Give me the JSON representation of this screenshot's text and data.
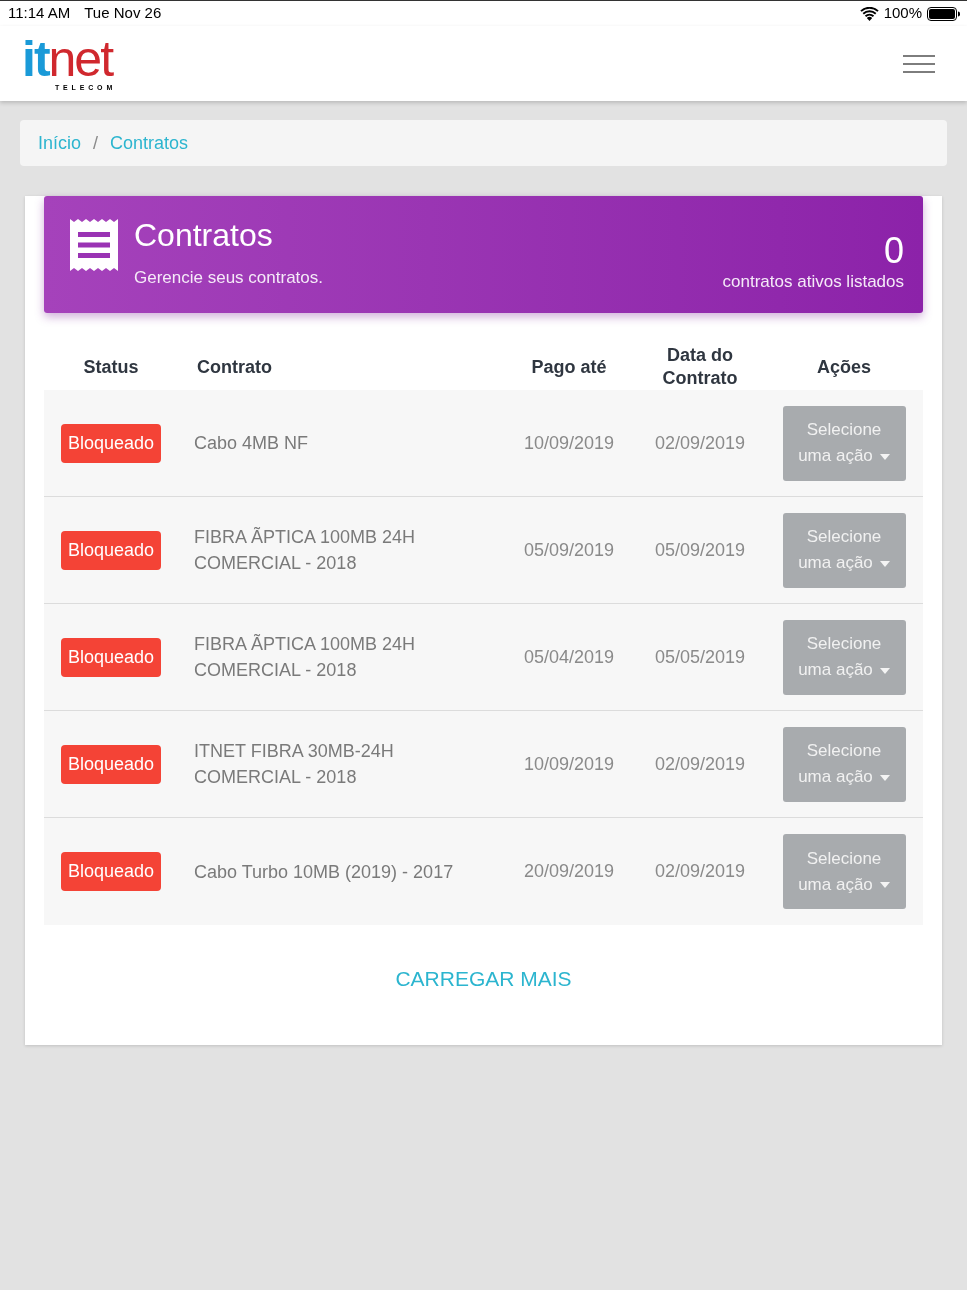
{
  "status_bar": {
    "time": "11:14 AM",
    "date": "Tue Nov 26",
    "battery": "100%"
  },
  "header": {
    "logo": {
      "part_1": "it",
      "part_2": "net",
      "tagline": "TELECOM"
    }
  },
  "breadcrumb": {
    "separator": "/",
    "items": [
      {
        "label": "Início"
      },
      {
        "label": "Contratos"
      }
    ]
  },
  "panel": {
    "title": "Contratos",
    "subtitle": "Gerencie seus contratos.",
    "count": "0",
    "count_label": "contratos ativos listados"
  },
  "table": {
    "columns": [
      "Status",
      "Contrato",
      "Pago até",
      "Data do Contrato",
      "Ações"
    ],
    "rows": [
      {
        "status": "Bloqueado",
        "contract": "Cabo 4MB NF",
        "paid_until": "10/09/2019",
        "contract_date": "02/09/2019",
        "action": "Selecione uma ação"
      },
      {
        "status": "Bloqueado",
        "contract": "FIBRA ÃPTICA 100MB 24H COMERCIAL - 2018",
        "paid_until": "05/09/2019",
        "contract_date": "05/09/2019",
        "action": "Selecione uma ação"
      },
      {
        "status": "Bloqueado",
        "contract": "FIBRA ÃPTICA 100MB 24H COMERCIAL - 2018",
        "paid_until": "05/04/2019",
        "contract_date": "05/05/2019",
        "action": "Selecione uma ação"
      },
      {
        "status": "Bloqueado",
        "contract": "ITNET FIBRA 30MB-24H COMERCIAL - 2018",
        "paid_until": "10/09/2019",
        "contract_date": "02/09/2019",
        "action": "Selecione uma ação"
      },
      {
        "status": "Bloqueado",
        "contract": "Cabo Turbo 10MB (2019) - 2017",
        "paid_until": "20/09/2019",
        "contract_date": "02/09/2019",
        "action": "Selecione uma ação"
      }
    ]
  },
  "load_more": "CARREGAR MAIS"
}
